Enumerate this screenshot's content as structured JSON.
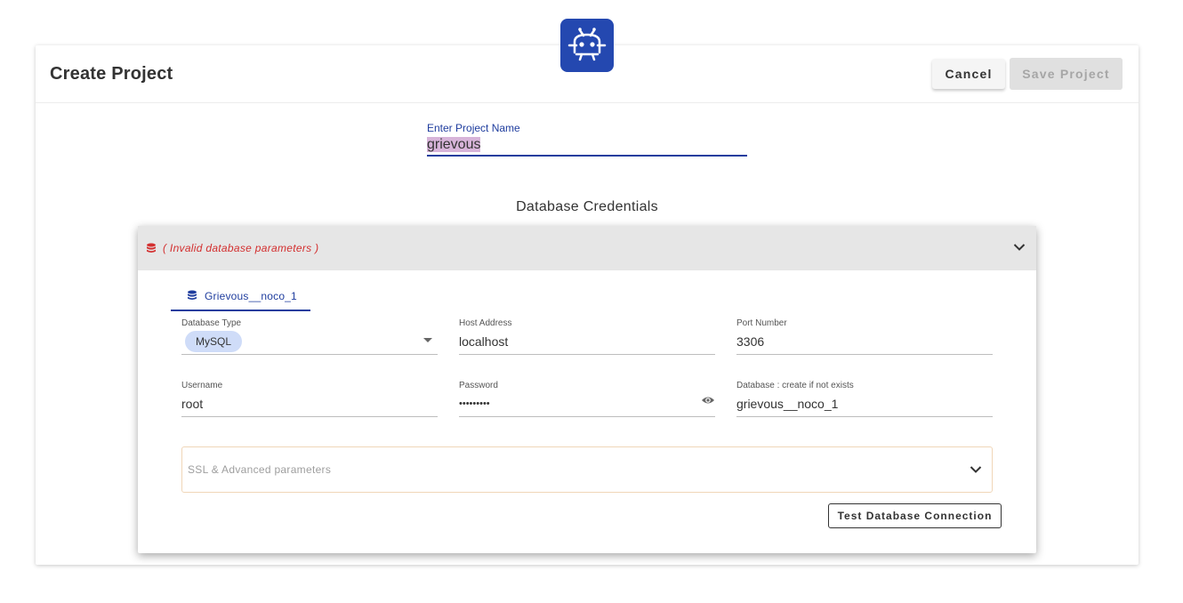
{
  "header": {
    "title": "Create Project",
    "cancel_label": "Cancel",
    "save_label": "Save Project"
  },
  "project": {
    "name_label": "Enter Project Name",
    "name_value": "grievous"
  },
  "db_section_title": "Database Credentials",
  "panel": {
    "error_text": "( Invalid database parameters )",
    "tab_label": "Grievous__noco_1",
    "fields": {
      "db_type": {
        "label": "Database Type",
        "value": "MySQL"
      },
      "host": {
        "label": "Host Address",
        "value": "localhost"
      },
      "port": {
        "label": "Port Number",
        "value": "3306"
      },
      "username": {
        "label": "Username",
        "value": "root"
      },
      "password": {
        "label": "Password",
        "value": "•••••••••"
      },
      "database": {
        "label": "Database : create if not exists",
        "value": "grievous__noco_1"
      }
    },
    "ssl_label": "SSL & Advanced parameters",
    "test_label": "Test Database Connection"
  },
  "icons": {
    "logo": "nocodb-logo-icon",
    "database": "database-icon",
    "chevron": "chevron-down-icon",
    "eye": "eye-icon"
  },
  "colors": {
    "accent": "#1f3d9e",
    "logo_bg": "#2448b0",
    "error": "#d32f2f",
    "chip_bg": "#cfdcf8",
    "selection": "#d7b4d9"
  }
}
